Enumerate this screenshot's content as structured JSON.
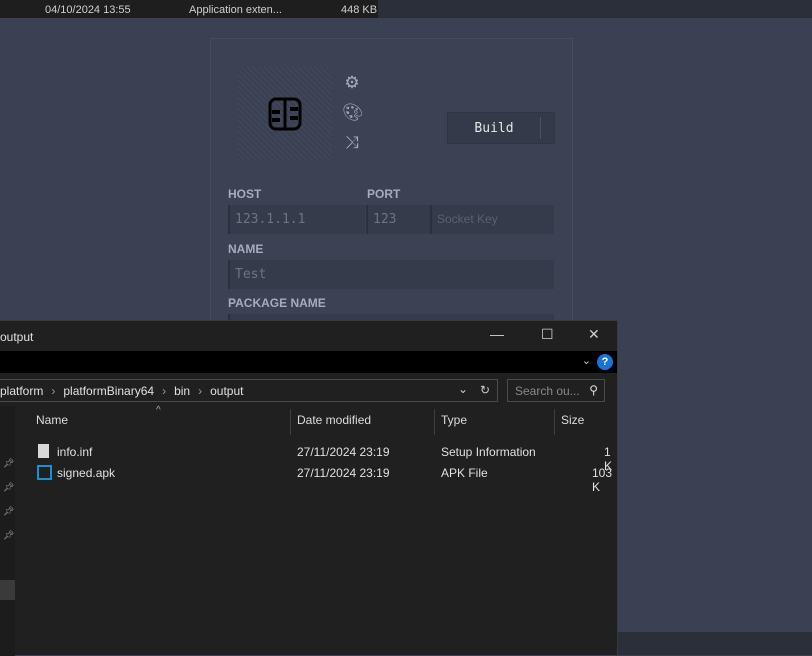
{
  "background_file_row": {
    "date": "04/10/2024 13:55",
    "type": "Application exten...",
    "size": "448 KB"
  },
  "builder": {
    "icons": [
      "gear-icon",
      "palette-icon",
      "shuffle-icon"
    ],
    "build_label": "Build",
    "host_label": "HOST",
    "host_value": "123.1.1.1",
    "port_label": "PORT",
    "port_value": "123",
    "socket_key_placeholder": "Socket Key",
    "name_label": "NAME",
    "name_value": "Test",
    "package_label": "PACKAGE NAME"
  },
  "explorer": {
    "title": "output",
    "breadcrumb": [
      "platform",
      "platformBinary64",
      "bin",
      "output"
    ],
    "search_placeholder": "Search ou...",
    "columns": [
      "Name",
      "Date modified",
      "Type",
      "Size"
    ],
    "files": [
      {
        "name": "info.inf",
        "date": "27/11/2024 23:19",
        "type": "Setup Information",
        "size": "1 K"
      },
      {
        "name": "signed.apk",
        "date": "27/11/2024 23:19",
        "type": "APK File",
        "size": "103 K"
      }
    ]
  }
}
